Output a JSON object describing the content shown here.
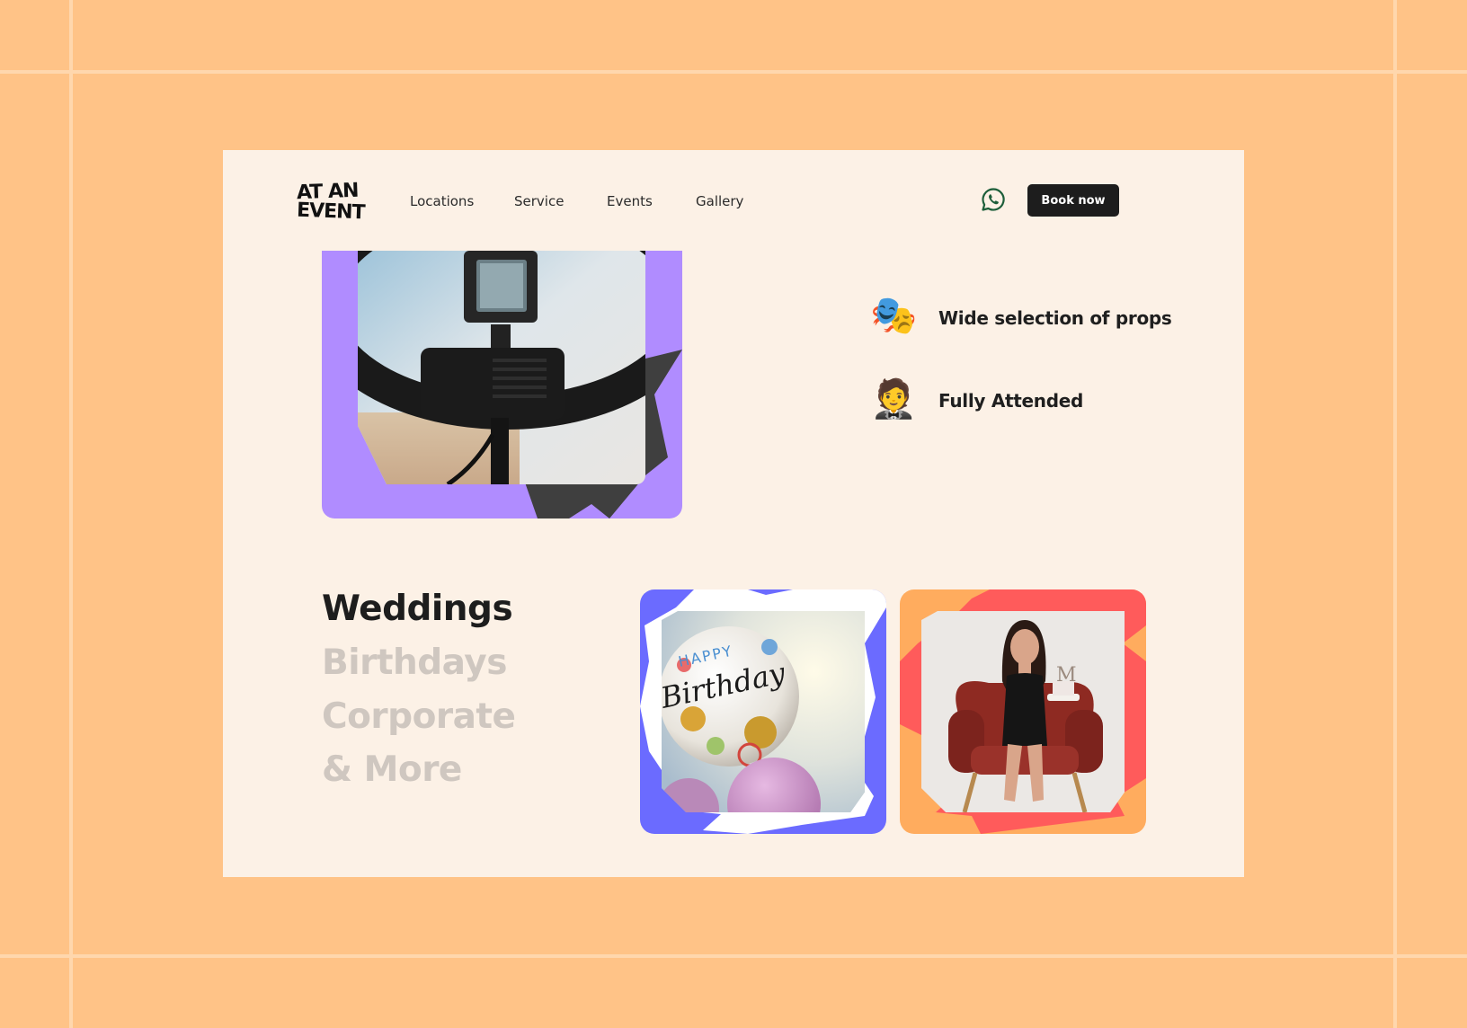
{
  "brand": {
    "logo_line1": "AT AN",
    "logo_line2": "EVENT"
  },
  "nav": {
    "links": [
      "Locations",
      "Service",
      "Events",
      "Gallery"
    ],
    "book_label": "Book now"
  },
  "features": [
    {
      "icon": "performing-arts-masks-icon",
      "emoji": "🎭",
      "label": "Wide selection of props"
    },
    {
      "icon": "man-in-tuxedo-icon",
      "emoji": "🤵",
      "label": "Fully Attended"
    }
  ],
  "event_types": [
    "Weddings",
    "Birthdays",
    "Corporate",
    "& More"
  ],
  "active_event_type": "Weddings",
  "colors": {
    "page_bg": "#ffc387",
    "frame_bg": "#fcf1e6",
    "hero_accent": "#b08cff",
    "card1_accent": "#6b6bff",
    "card2_accent": "#ffac5e",
    "card2_stroke": "#ff5b5b",
    "button_bg": "#1d1d1d"
  },
  "balloon_text": {
    "line1": "HAPPY",
    "line2": "Birthday"
  }
}
